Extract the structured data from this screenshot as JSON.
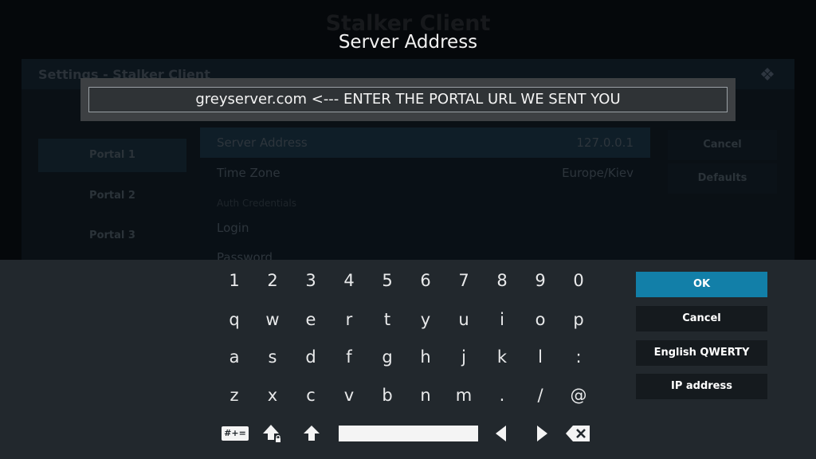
{
  "background": {
    "app_title": "Stalker Client",
    "window_title": "Settings - Stalker Client",
    "portals": [
      "Portal 1",
      "Portal 2",
      "Portal 3"
    ],
    "settings": [
      {
        "label": "Server Address",
        "value": "127.0.0.1"
      },
      {
        "label": "Time Zone",
        "value": "Europe/Kiev"
      }
    ],
    "section_label": "Auth Credentials",
    "login_label": "Login",
    "password_label": "Password",
    "side_buttons": [
      "Cancel",
      "Defaults"
    ]
  },
  "dialog": {
    "title": "Server Address",
    "input_value": "greyserver.com <--- ENTER THE PORTAL URL WE SENT YOU"
  },
  "keyboard": {
    "rows": [
      [
        "1",
        "2",
        "3",
        "4",
        "5",
        "6",
        "7",
        "8",
        "9",
        "0"
      ],
      [
        "q",
        "w",
        "e",
        "r",
        "t",
        "y",
        "u",
        "i",
        "o",
        "p"
      ],
      [
        "a",
        "s",
        "d",
        "f",
        "g",
        "h",
        "j",
        "k",
        "l",
        ":"
      ],
      [
        "z",
        "x",
        "c",
        "v",
        "b",
        "n",
        "m",
        ".",
        "/",
        "@"
      ]
    ],
    "symbols_label": "#+=",
    "buttons": {
      "ok": "OK",
      "cancel": "Cancel",
      "layout": "English QWERTY",
      "ip": "IP address"
    }
  },
  "colors": {
    "accent": "#127fa8",
    "panel": "#22282d"
  }
}
